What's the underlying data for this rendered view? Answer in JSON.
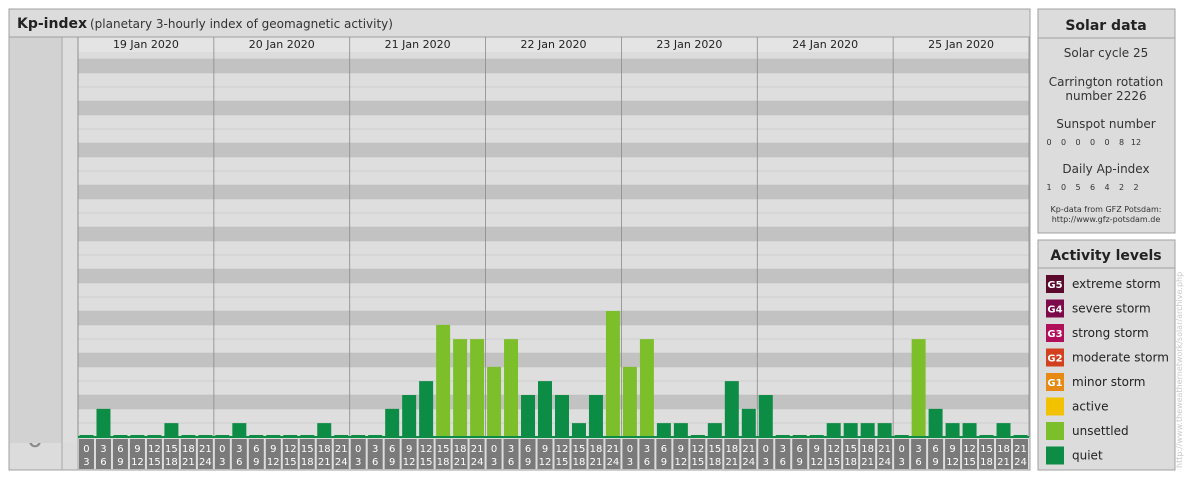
{
  "header": {
    "title": "Kp-index",
    "subtitle": "(planetary 3-hourly index of geomagnetic activity)"
  },
  "chart_data": {
    "type": "bar",
    "title": "Kp-index",
    "subtitle": "(planetary 3-hourly index of geomagnetic activity)",
    "xlabel": "",
    "ylabel": "",
    "ylim": [
      0,
      9
    ],
    "y_major_ticks": [
      "0",
      "1",
      "2",
      "3",
      "4",
      "5",
      "6",
      "7",
      "8",
      "9"
    ],
    "y_minor_labels": [
      "o",
      "+",
      "-"
    ],
    "days": [
      "19 Jan 2020",
      "20 Jan 2020",
      "21 Jan 2020",
      "22 Jan 2020",
      "23 Jan 2020",
      "24 Jan 2020",
      "25 Jan 2020"
    ],
    "interval_starts": [
      "0",
      "3",
      "6",
      "9",
      "12",
      "15",
      "18",
      "21"
    ],
    "interval_ends": [
      "3",
      "6",
      "9",
      "12",
      "15",
      "18",
      "21",
      "24"
    ],
    "values": [
      [
        0,
        0.67,
        0,
        0,
        0,
        0.33,
        0,
        0
      ],
      [
        0,
        0.33,
        0,
        0,
        0,
        0,
        0.33,
        0
      ],
      [
        0,
        0,
        0.67,
        1,
        1.33,
        2.67,
        2.33,
        2.33
      ],
      [
        1.67,
        2.33,
        1,
        1.33,
        1,
        0.33,
        1,
        3
      ],
      [
        1.67,
        2.33,
        0.33,
        0.33,
        0,
        0.33,
        1.33,
        0.67
      ],
      [
        1,
        0,
        0,
        0,
        0.33,
        0.33,
        0.33,
        0.33
      ],
      [
        0,
        2.33,
        0.67,
        0.33,
        0.33,
        0,
        0.33,
        0
      ]
    ],
    "levels": [
      {
        "max": 4.5,
        "color": "#0c8c44",
        "label": "quiet"
      },
      {
        "max": 5,
        "color": "#7dbf2a",
        "label": "unsettled"
      }
    ],
    "grid": true
  },
  "solar_data": {
    "title": "Solar data",
    "solar_cycle": "Solar cycle 25",
    "carrington_line1": "Carrington rotation",
    "carrington_line2": "number 2226",
    "sunspot_title": "Sunspot number",
    "sunspot_values": [
      "0",
      "0",
      "0",
      "0",
      "0",
      "8",
      "12"
    ],
    "ap_title": "Daily Ap-index",
    "ap_values": [
      "1",
      "0",
      "5",
      "6",
      "4",
      "2",
      "2"
    ],
    "source_line1": "Kp-data from GFZ Potsdam:",
    "source_line2": "http://www.gfz-potsdam.de"
  },
  "activity_levels": {
    "title": "Activity levels",
    "items": [
      {
        "badge": "G5",
        "label": "extreme storm",
        "color": "#5b0a2e"
      },
      {
        "badge": "G4",
        "label": "severe storm",
        "color": "#7d0a4a"
      },
      {
        "badge": "G3",
        "label": "strong storm",
        "color": "#b0105a"
      },
      {
        "badge": "G2",
        "label": "moderate storm",
        "color": "#d2401e"
      },
      {
        "badge": "G1",
        "label": "minor storm",
        "color": "#e68a14"
      },
      {
        "badge": "",
        "label": "active",
        "color": "#f2c200"
      },
      {
        "badge": "",
        "label": "unsettled",
        "color": "#7dbf2a"
      },
      {
        "badge": "",
        "label": "quiet",
        "color": "#0c8c44"
      }
    ]
  },
  "watermark": "http://www.theweathernetwork/solar/archive.php"
}
